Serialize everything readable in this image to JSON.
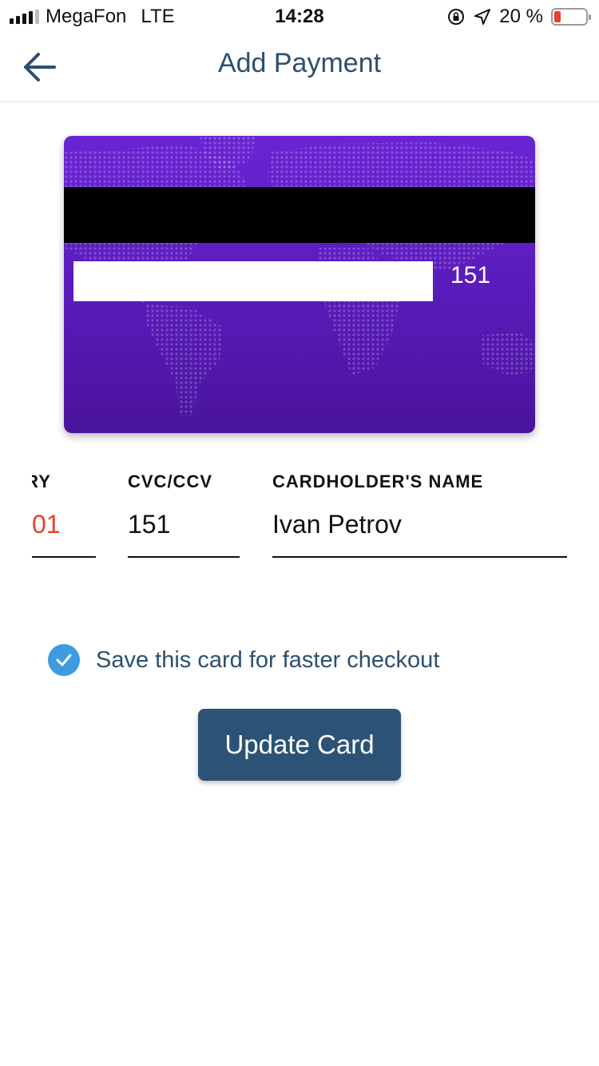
{
  "status_bar": {
    "carrier": "MegaFon",
    "network": "LTE",
    "time": "14:28",
    "battery_text": "20 %",
    "battery_level": 0.2,
    "battery_color": "#e8412f"
  },
  "nav": {
    "title": "Add Payment",
    "back_icon": "arrow-left-icon"
  },
  "card": {
    "cvc_display": "151",
    "gradient_top": "#6a24d4",
    "gradient_bottom": "#4a149c"
  },
  "form": {
    "expiry": {
      "label": "EXPIRY",
      "value": "01",
      "value_color": "#e8412f"
    },
    "cvc": {
      "label": "CVC/CCV",
      "value": "151"
    },
    "name": {
      "label": "CARDHOLDER'S NAME",
      "value": "Ivan Petrov"
    }
  },
  "save_card": {
    "label": "Save this card for faster checkout",
    "checked": true,
    "check_color": "#3e9be0"
  },
  "update_button": {
    "label": "Update Card",
    "color": "#2c5376"
  }
}
